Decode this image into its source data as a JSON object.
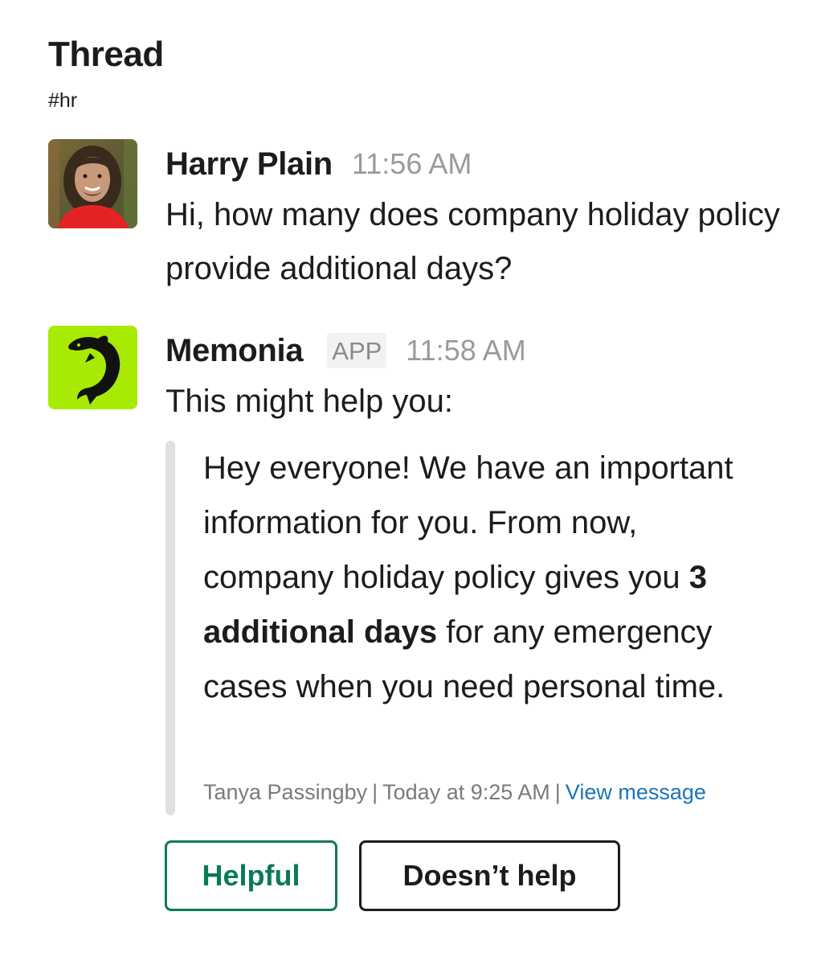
{
  "header": {
    "title": "Thread",
    "channel": "#hr"
  },
  "messages": [
    {
      "author": "Harry Plain",
      "time": "11:56 AM",
      "text": "Hi, how many does company holiday policy provide additional days?",
      "avatar": "user-photo"
    },
    {
      "author": "Memonia",
      "badge": "APP",
      "time": "11:58 AM",
      "text": "This might help you:",
      "avatar": "dolphin-icon",
      "avatar_bg": "#a8ea04",
      "quote": {
        "text_before": "Hey everyone! We have an important information for you. From now, company holiday policy gives you ",
        "text_bold": "3 additional days",
        "text_after": " for any emergency cases when you need personal time.",
        "source_author": "Tanya Passingby",
        "source_time": "Today at 9:25 AM",
        "separator": "|",
        "link_label": "View message"
      }
    }
  ],
  "actions": {
    "helpful_label": "Helpful",
    "not_helpful_label": "Doesn’t help",
    "helpful_color": "#0a7a5a"
  }
}
